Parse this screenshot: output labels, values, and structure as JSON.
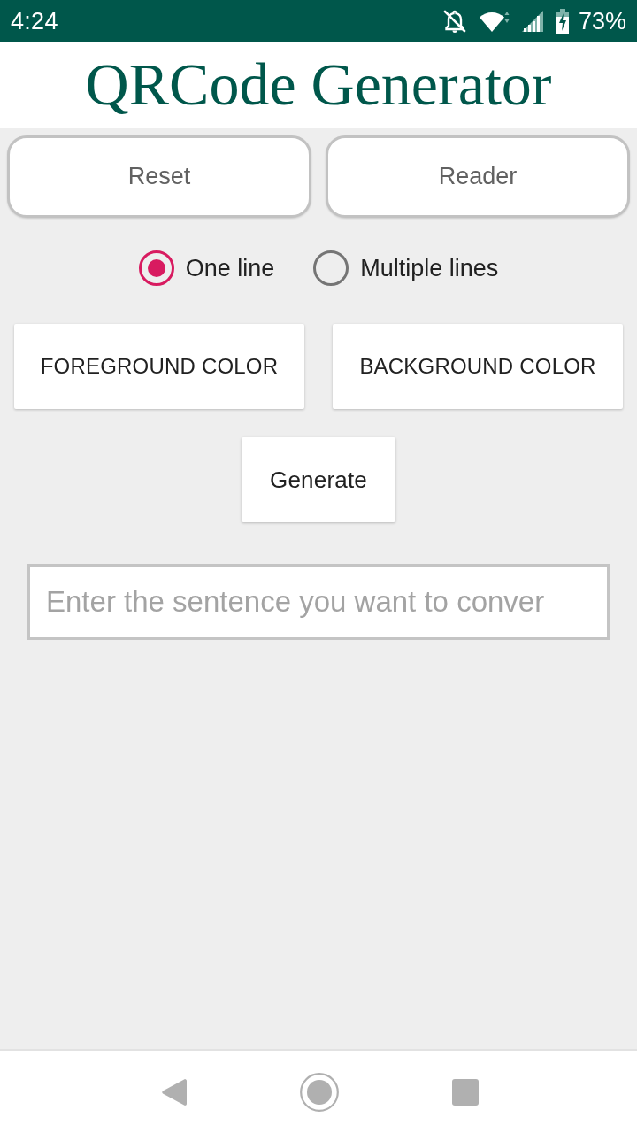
{
  "status_bar": {
    "time": "4:24",
    "battery": "73%"
  },
  "app_bar": {
    "title": "QRCode Generator"
  },
  "top_buttons": [
    {
      "label": "Reset"
    },
    {
      "label": "Reader"
    }
  ],
  "line_mode": [
    {
      "label": "One line",
      "selected": true
    },
    {
      "label": "Multiple lines",
      "selected": false
    }
  ],
  "color_buttons": [
    {
      "label": "FOREGROUND COLOR"
    },
    {
      "label": "BACKGROUND COLOR"
    }
  ],
  "generate_button": {
    "label": "Generate"
  },
  "text_input": {
    "placeholder": "Enter the sentence you want to conver"
  }
}
